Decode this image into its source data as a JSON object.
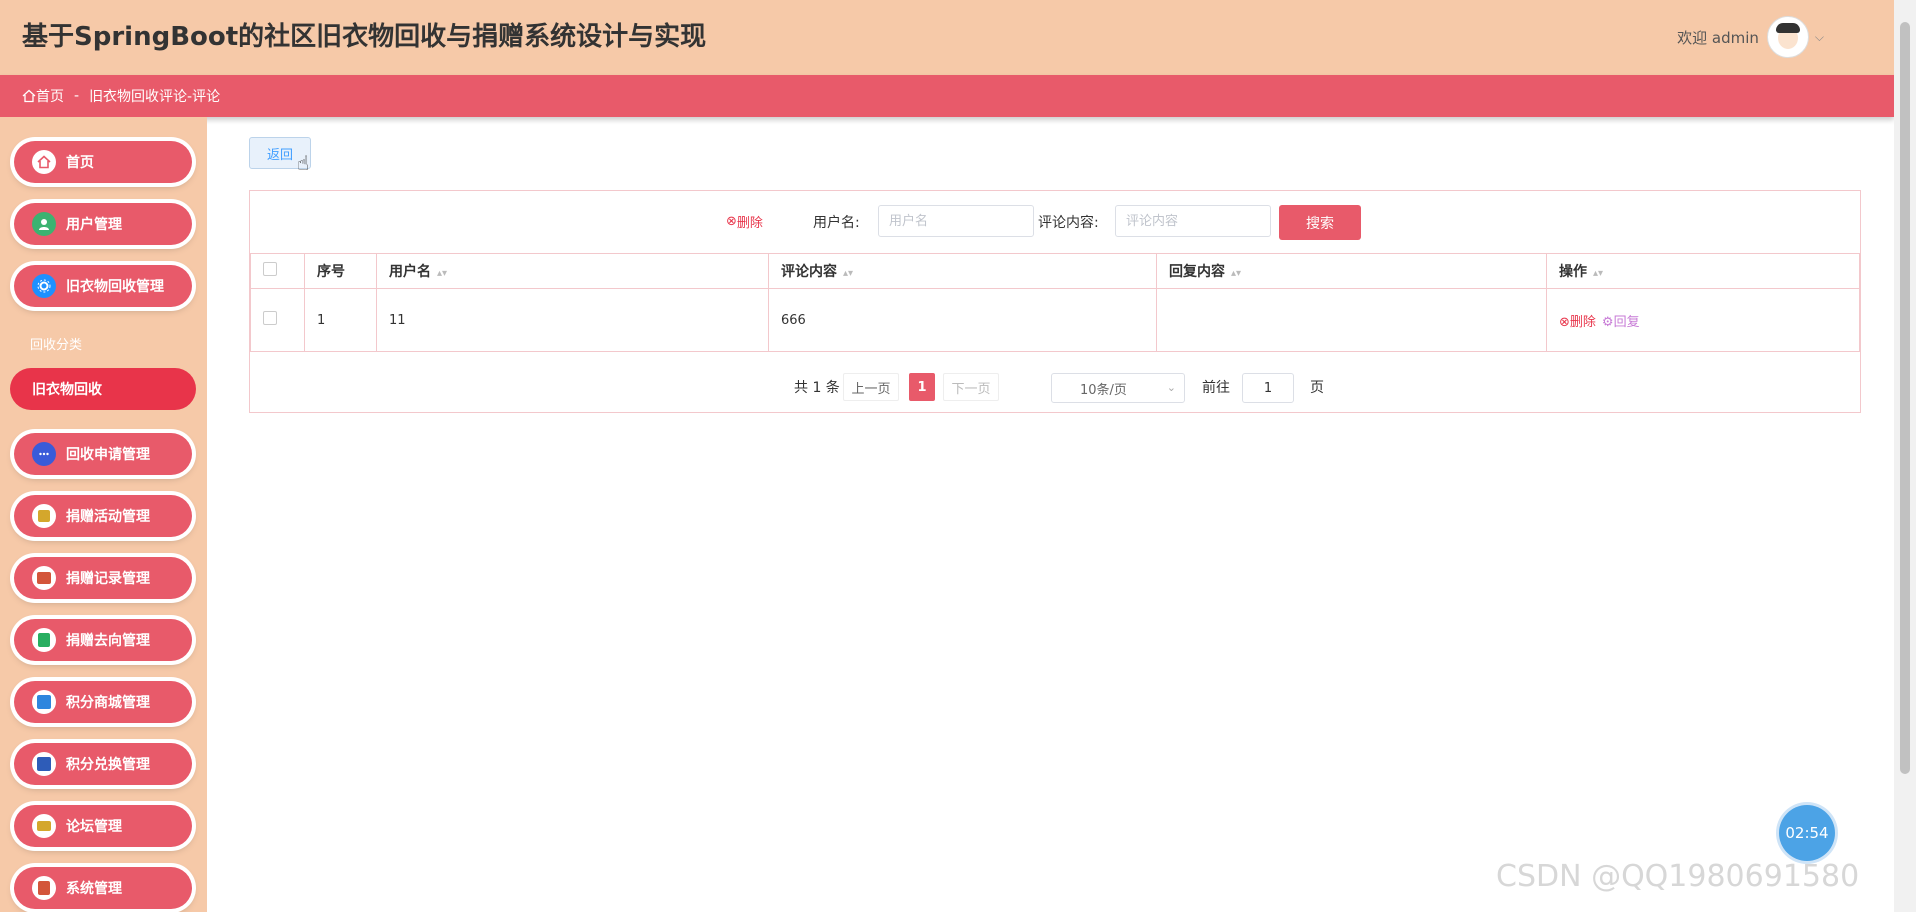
{
  "header": {
    "app_title": "基于SpringBoot的社区旧衣物回收与捐赠系统设计与实现",
    "welcome": "欢迎 admin"
  },
  "breadcrumb": {
    "home": "首页",
    "separator": "-",
    "current": "旧衣物回收评论-评论"
  },
  "sidebar": {
    "items": [
      {
        "label": "首页",
        "icon": "home-icon",
        "color": "#e85a6a"
      },
      {
        "label": "用户管理",
        "icon": "user-icon",
        "color": "#3cb371"
      },
      {
        "label": "旧衣物回收管理",
        "icon": "gear-icon",
        "color": "#1e90ff"
      },
      {
        "label": "回收申请管理",
        "icon": "chat-icon",
        "color": "#3a5bd9"
      },
      {
        "label": "捐赠活动管理",
        "icon": "tag-icon",
        "color": "#d4a72c"
      },
      {
        "label": "捐赠记录管理",
        "icon": "box-icon",
        "color": "#d3553a"
      },
      {
        "label": "捐赠去向管理",
        "icon": "save-icon",
        "color": "#27ae60"
      },
      {
        "label": "积分商城管理",
        "icon": "grid-icon",
        "color": "#2e86de"
      },
      {
        "label": "积分兑换管理",
        "icon": "book-icon",
        "color": "#2e5cb8"
      },
      {
        "label": "论坛管理",
        "icon": "ticket-icon",
        "color": "#d4a72c"
      },
      {
        "label": "系统管理",
        "icon": "settings-icon",
        "color": "#d3553a"
      }
    ],
    "sub_items": [
      "回收分类",
      "旧衣物回收"
    ]
  },
  "main": {
    "back_label": "返回",
    "delete_label": "删除",
    "search": {
      "username_label": "用户名:",
      "username_placeholder": "用户名",
      "content_label": "评论内容:",
      "content_placeholder": "评论内容",
      "button": "搜索"
    },
    "table": {
      "columns": [
        "序号",
        "用户名",
        "评论内容",
        "回复内容",
        "操作"
      ],
      "rows": [
        {
          "index": "1",
          "username": "11",
          "content": "666",
          "reply": "",
          "ops": [
            "删除",
            "回复"
          ]
        }
      ]
    },
    "pagination": {
      "total": "共 1 条",
      "prev": "上一页",
      "current": "1",
      "next": "下一页",
      "page_size": "10条/页",
      "goto_label": "前往",
      "goto_value": "1",
      "goto_suffix": "页"
    }
  },
  "overlay": {
    "timer": "02:54",
    "watermark": "CSDN @QQ1980691580"
  }
}
